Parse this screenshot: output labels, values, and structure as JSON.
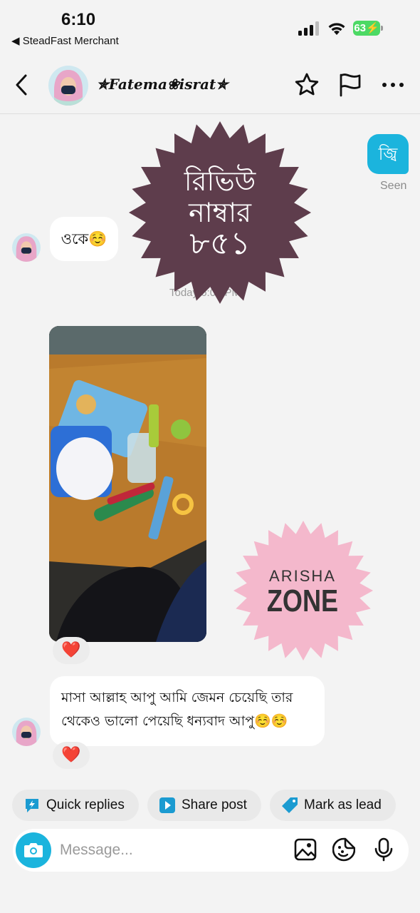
{
  "status_bar": {
    "time": "6:10",
    "back_app": "◀ SteadFast Merchant",
    "battery": "63",
    "icons": [
      "cellular-signal-icon",
      "wifi-icon",
      "battery-charging-icon"
    ]
  },
  "header": {
    "contact_name": "✯Fatema❀israt✯",
    "icons": [
      "back-chevron-icon",
      "star-icon",
      "flag-icon",
      "more-icon"
    ]
  },
  "messages": {
    "outgoing_1": {
      "text": "জ্বি",
      "status": "Seen"
    },
    "incoming_1": {
      "text": "ওকে☺️"
    },
    "timestamp": "Today 6:09 PM",
    "photo_reaction": "❤️",
    "incoming_2": {
      "text": "মাসা আল্লাহ আপু আমি জেমন চেয়েছি তার থেকেও ভালো পেয়েছি ধন্যবাদ আপু☺️☺️",
      "reaction": "❤️"
    }
  },
  "overlays": {
    "review_label": [
      "রিভিউ",
      "নাম্বার",
      "৮৫১"
    ],
    "brand_top": "ARISHA",
    "brand_bottom": "ZONE"
  },
  "quick_actions": [
    {
      "label": "Quick replies",
      "icon": "lightning-bubble-icon"
    },
    {
      "label": "Share post",
      "icon": "play-square-icon"
    },
    {
      "label": "Mark as lead",
      "icon": "tag-icon"
    }
  ],
  "composer": {
    "placeholder": "Message...",
    "icons": [
      "camera-icon",
      "image-icon",
      "sticker-icon",
      "microphone-icon"
    ]
  },
  "colors": {
    "accent": "#1bb4dd",
    "review_badge": "#5e3d4c",
    "brand_badge": "#f4b8cc",
    "reaction": "#e0202e"
  }
}
